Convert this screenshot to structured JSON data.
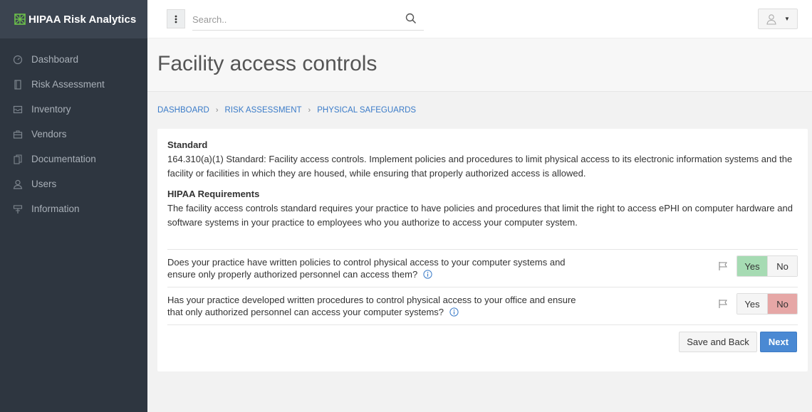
{
  "app": {
    "brand": "HIPAA Risk Analytics",
    "accent": "#4a89d3"
  },
  "sidebar": {
    "items": [
      {
        "label": "Dashboard",
        "icon": "dashboard-icon"
      },
      {
        "label": "Risk Assessment",
        "icon": "document-icon"
      },
      {
        "label": "Inventory",
        "icon": "inbox-icon"
      },
      {
        "label": "Vendors",
        "icon": "briefcase-icon"
      },
      {
        "label": "Documentation",
        "icon": "docs-icon"
      },
      {
        "label": "Users",
        "icon": "user-icon"
      },
      {
        "label": "Information",
        "icon": "info-sign-icon"
      }
    ]
  },
  "topbar": {
    "search_placeholder": "Search.."
  },
  "page": {
    "title": "Facility access controls"
  },
  "breadcrumb": [
    "DASHBOARD",
    "RISK ASSESSMENT",
    "PHYSICAL SAFEGUARDS"
  ],
  "standard": {
    "heading": "Standard",
    "text": "164.310(a)(1) Standard: Facility access controls. Implement policies and procedures to limit physical access to its electronic information systems and the facility or facilities in which they are housed, while ensuring that properly authorized access is allowed."
  },
  "requirements": {
    "heading": "HIPAA Requirements",
    "text": "The facility access controls standard requires your practice to have policies and procedures that limit the right to access ePHI on computer hardware and software systems in your practice to employees who you authorize to access your computer system."
  },
  "questions": [
    {
      "text": "Does your practice have written policies to control physical access to your computer systems and ensure only properly authorized personnel can access them?",
      "answer": "Yes"
    },
    {
      "text": "Has your practice developed written procedures to control physical access to your office and ensure that only authorized personnel can access your computer systems?",
      "answer": "No"
    }
  ],
  "labels": {
    "yes": "Yes",
    "no": "No"
  },
  "actions": {
    "save_back": "Save and Back",
    "next": "Next"
  }
}
